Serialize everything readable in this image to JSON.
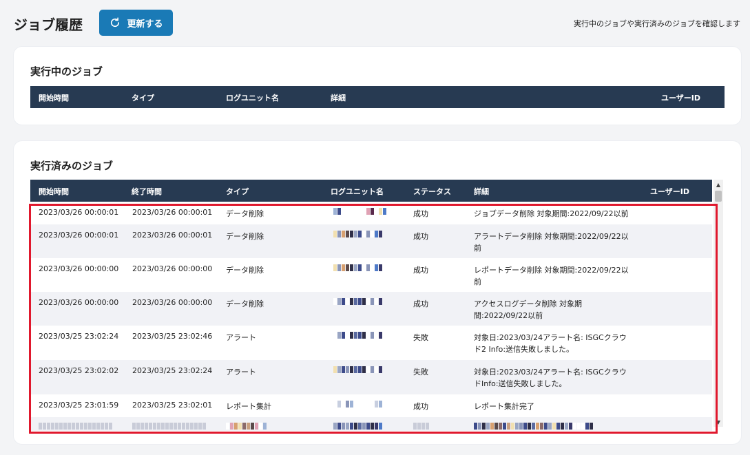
{
  "header": {
    "title": "ジョブ履歴",
    "refresh_label": "更新する",
    "description": "実行中のジョブや実行済みのジョブを確認します"
  },
  "running": {
    "title": "実行中のジョブ",
    "columns": [
      "開始時間",
      "タイプ",
      "ログユニット名",
      "詳細",
      "ユーザーID"
    ]
  },
  "completed": {
    "title": "実行済みのジョブ",
    "columns": [
      "開始時間",
      "終了時間",
      "タイプ",
      "ログユニット名",
      "ステータス",
      "詳細",
      "ユーザーID"
    ],
    "rows": [
      {
        "start": "2023/03/26 00:00:01",
        "end": "2023/03/26 00:00:01",
        "type": "データ削除",
        "status": "成功",
        "detail": "ジョブデータ削除 対象期間:2022/09/22以前"
      },
      {
        "start": "2023/03/26 00:00:01",
        "end": "2023/03/26 00:00:01",
        "type": "データ削除",
        "status": "成功",
        "detail": "アラートデータ削除 対象期間:2022/09/22以前"
      },
      {
        "start": "2023/03/26 00:00:00",
        "end": "2023/03/26 00:00:00",
        "type": "データ削除",
        "status": "成功",
        "detail": "レポートデータ削除 対象期間:2022/09/22以前"
      },
      {
        "start": "2023/03/26 00:00:00",
        "end": "2023/03/26 00:00:00",
        "type": "データ削除",
        "status": "成功",
        "detail": "アクセスログデータ削除 対象期間:2022/09/22以前"
      },
      {
        "start": "2023/03/25 23:02:24",
        "end": "2023/03/25 23:02:46",
        "type": "アラート",
        "status": "失敗",
        "detail": "対象日:2023/03/24アラート名: ISGCクラウド2 Info:送信失敗しました。"
      },
      {
        "start": "2023/03/25 23:02:02",
        "end": "2023/03/25 23:02:24",
        "type": "アラート",
        "status": "失敗",
        "detail": "対象日:2023/03/24アラート名: ISGCクラウドInfo:送信失敗しました。"
      },
      {
        "start": "2023/03/25 23:01:59",
        "end": "2023/03/25 23:02:01",
        "type": "レポート集計",
        "status": "成功",
        "detail": "レポート集計完了"
      }
    ]
  },
  "colors": {
    "header_bg": "#273a52",
    "button_bg": "#1a7ab6",
    "highlight": "#e0182d",
    "alt_row": "#f1f2f6"
  }
}
